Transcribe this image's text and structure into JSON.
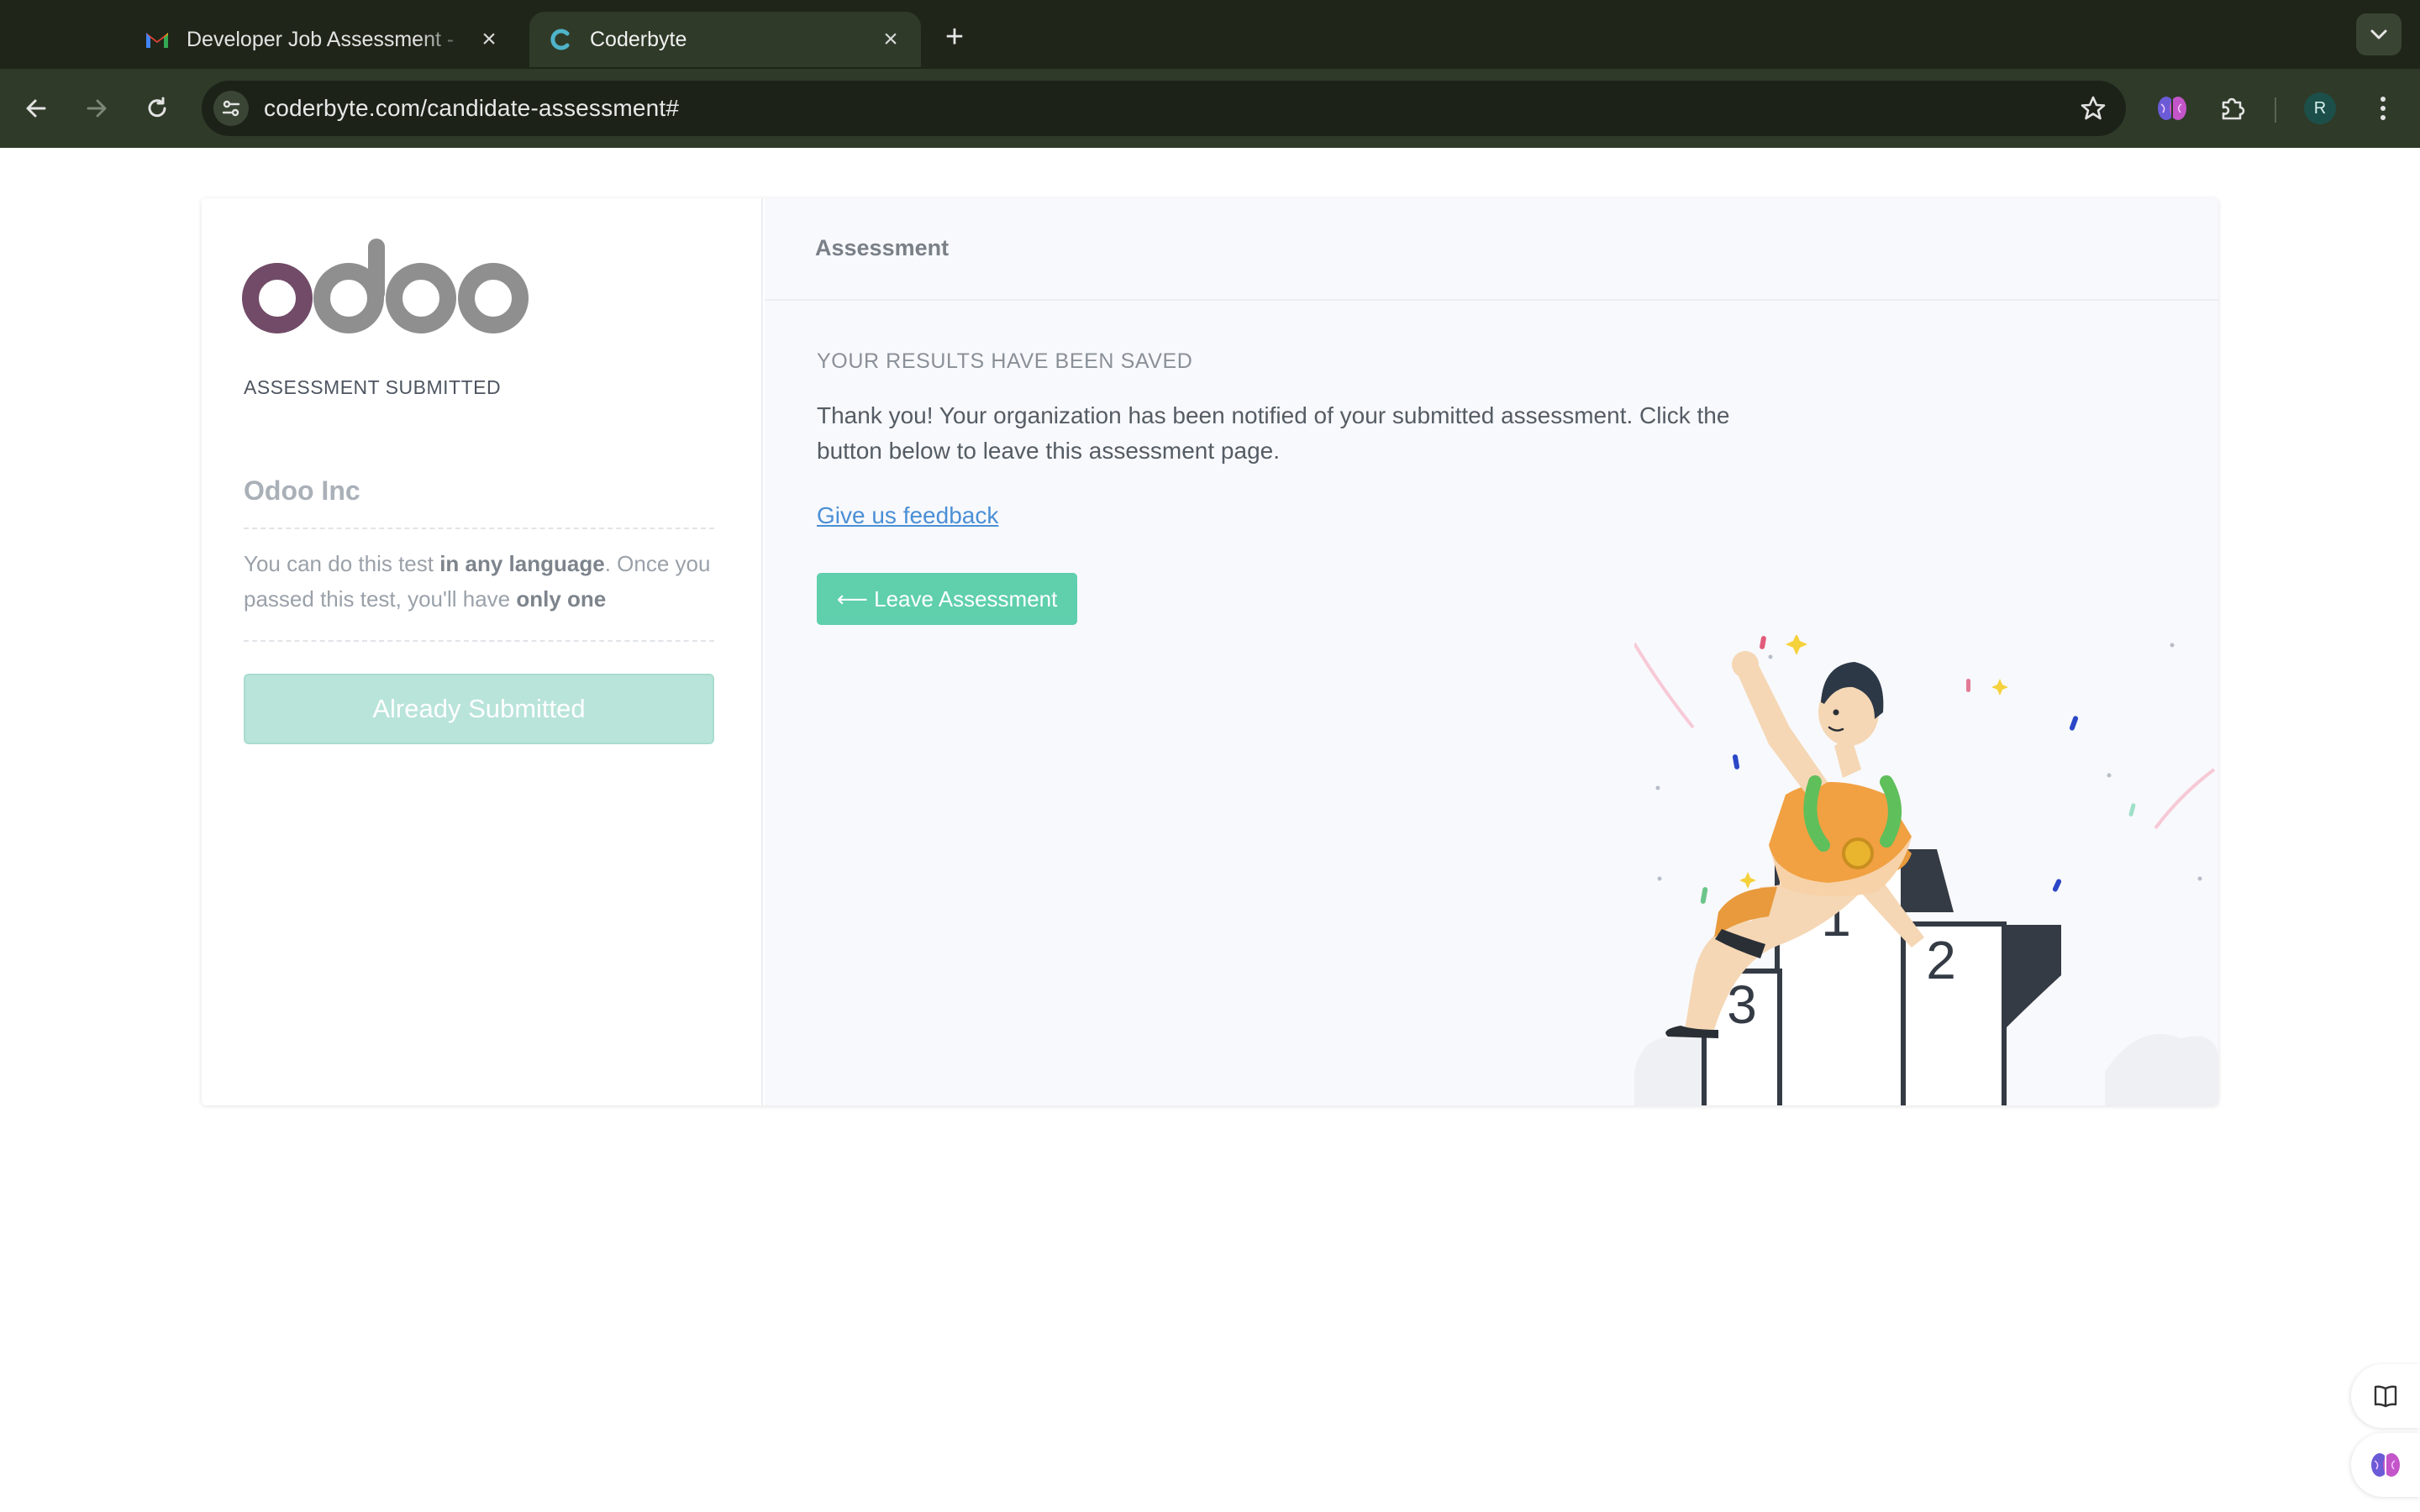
{
  "browser": {
    "tabs": [
      {
        "title": "Developer Job Assessment -",
        "favicon": "gmail-icon",
        "active": false
      },
      {
        "title": "Coderbyte",
        "favicon": "coderbyte-icon",
        "active": true
      }
    ],
    "url": "coderbyte.com/candidate-assessment#",
    "profile_initial": "R"
  },
  "sidebar": {
    "logo_text": "odoo",
    "status_label": "ASSESSMENT SUBMITTED",
    "company": "Odoo Inc",
    "description": {
      "part1": "You can do this test ",
      "bold1": "in any language",
      "part2": ". Once you passed this test, you'll have ",
      "bold2": "only one"
    },
    "submit_button": "Already Submitted"
  },
  "main": {
    "header_title": "Assessment",
    "saved_title": "YOUR RESULTS HAVE BEEN SAVED",
    "message": "Thank you! Your organization has been notified of your submitted assessment. Click the button below to leave this assessment page.",
    "feedback_link": "Give us feedback",
    "leave_button": "⟵ Leave Assessment",
    "podium": {
      "first": "1",
      "second": "2",
      "third": "3"
    }
  },
  "colors": {
    "accent": "#5fcfac",
    "accent_disabled": "#b9e4d9",
    "link": "#4a8fd6",
    "browser_frame": "#1f2619",
    "logo_purple": "#714b67",
    "logo_gray": "#8f8f8f"
  }
}
